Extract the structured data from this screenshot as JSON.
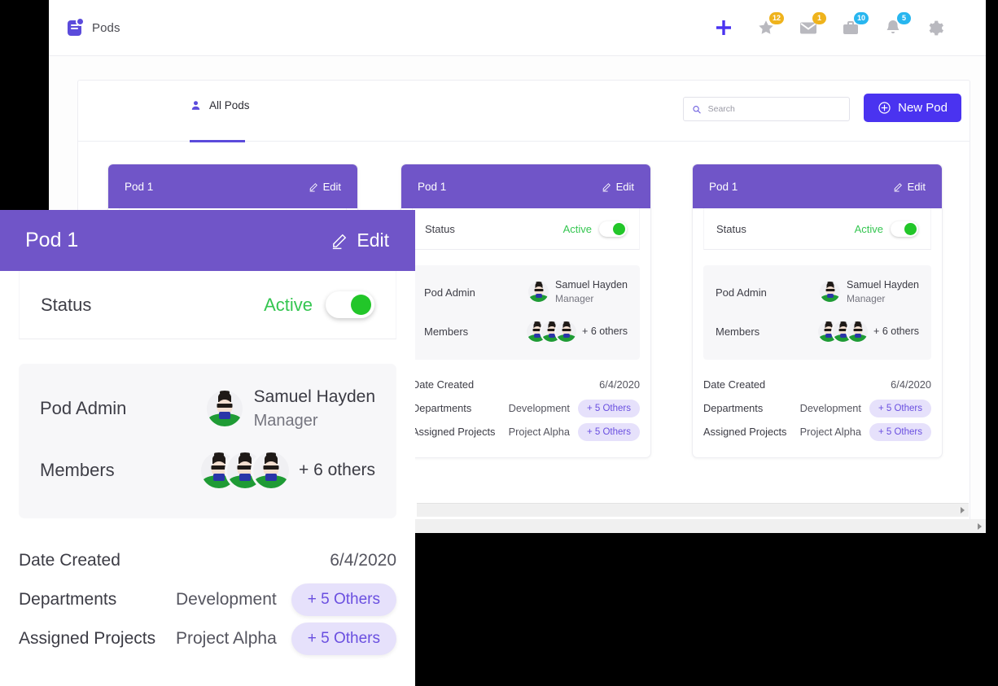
{
  "appbar": {
    "brand_label": "Pods",
    "brand_icon": "pods-logo-icon",
    "actions": [
      {
        "icon": "plus-icon",
        "name": "add",
        "badge": null,
        "badge_color": null
      },
      {
        "icon": "star-icon",
        "name": "favorites",
        "badge": "12",
        "badge_color": "#efb31c"
      },
      {
        "icon": "mail-icon",
        "name": "messages",
        "badge": "1",
        "badge_color": "#efb31c"
      },
      {
        "icon": "briefcase-icon",
        "name": "projects",
        "badge": "10",
        "badge_color": "#28b6ef"
      },
      {
        "icon": "bell-icon",
        "name": "notifications",
        "badge": "5",
        "badge_color": "#28b6ef"
      },
      {
        "icon": "gear-icon",
        "name": "settings",
        "badge": null,
        "badge_color": null
      }
    ]
  },
  "toolbar": {
    "tab_label": "All Pods",
    "tab_icon": "person-icon",
    "search_placeholder": "Search",
    "search_value": "",
    "search_icon": "search-icon",
    "new_pod_label": "New Pod",
    "new_pod_icon": "plus-circle-icon"
  },
  "card": {
    "title": "Pod 1",
    "edit_label": "Edit",
    "edit_icon": "pencil-icon",
    "status_label": "Status",
    "status_value": "Active",
    "status_on": true,
    "admin_label": "Pod Admin",
    "admin_name": "Samuel Hayden",
    "admin_role": "Manager",
    "members_label": "Members",
    "members_more": "+ 6 others",
    "meta": [
      {
        "label": "Date Created",
        "value": "6/4/2020",
        "pill": null
      },
      {
        "label": "Departments",
        "value": "Development",
        "pill": "+ 5 Others"
      },
      {
        "label": "Assigned Projects",
        "value": "Project Alpha",
        "pill": "+ 5 Others"
      }
    ]
  },
  "colors": {
    "card_header_purple": "#7055c8",
    "brand_indigo": "#5b4bdb",
    "button_indigo": "#4a33f0",
    "status_green": "#35c651",
    "toggle_green": "#22c629",
    "pill_bg": "#e6e1fb",
    "pill_text": "#6a4fe0",
    "badge_amber": "#efb31c",
    "badge_cyan": "#28b6ef"
  }
}
